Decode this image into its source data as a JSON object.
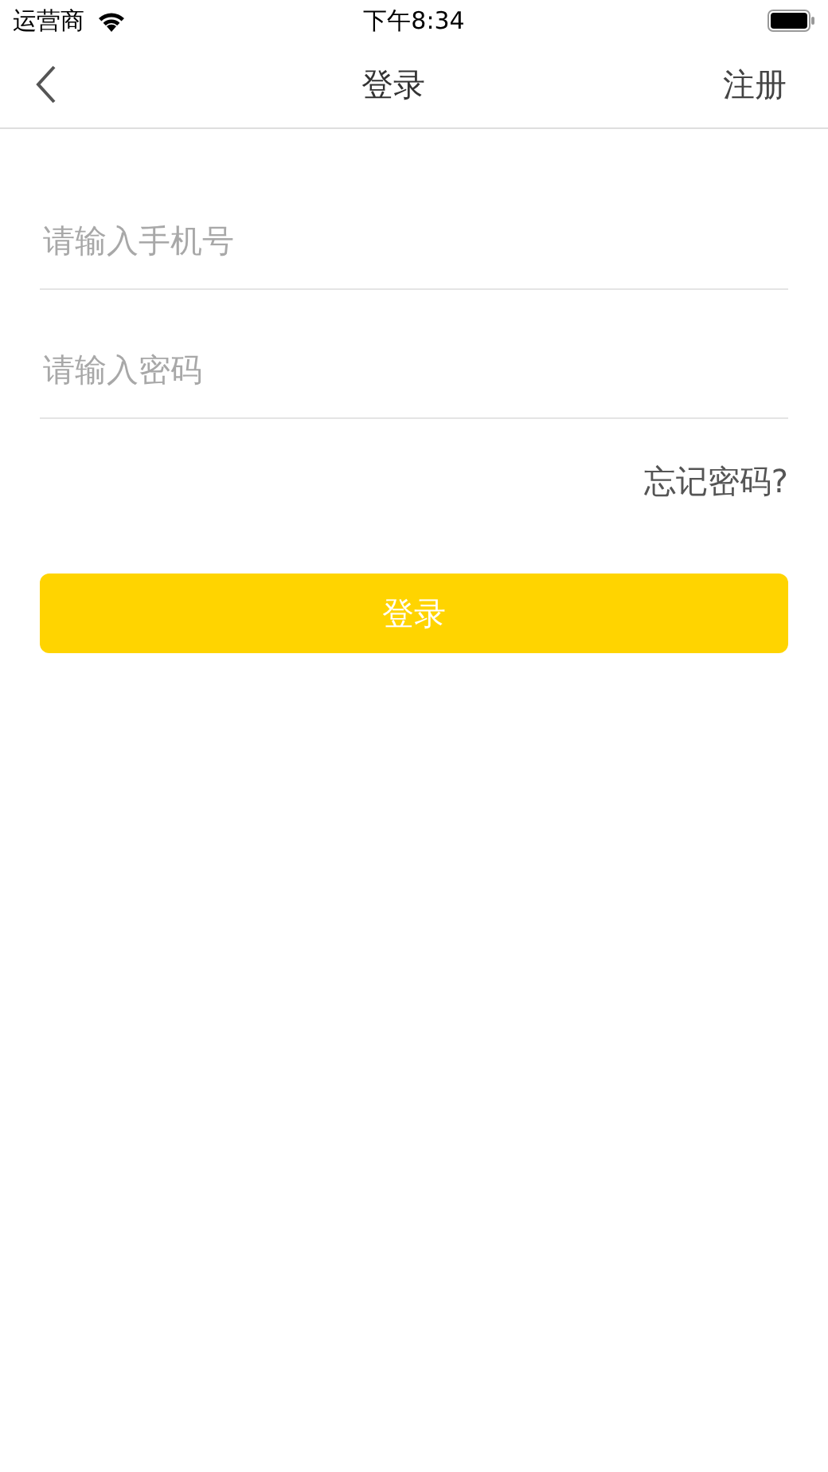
{
  "status_bar": {
    "carrier": "运营商",
    "time": "下午8:34"
  },
  "nav": {
    "title": "登录",
    "action": "注册"
  },
  "fields": [
    {
      "placeholder": "请输入手机号"
    },
    {
      "placeholder": "请输入密码"
    }
  ],
  "forgot_link": "忘记密码?",
  "submit": "登录"
}
